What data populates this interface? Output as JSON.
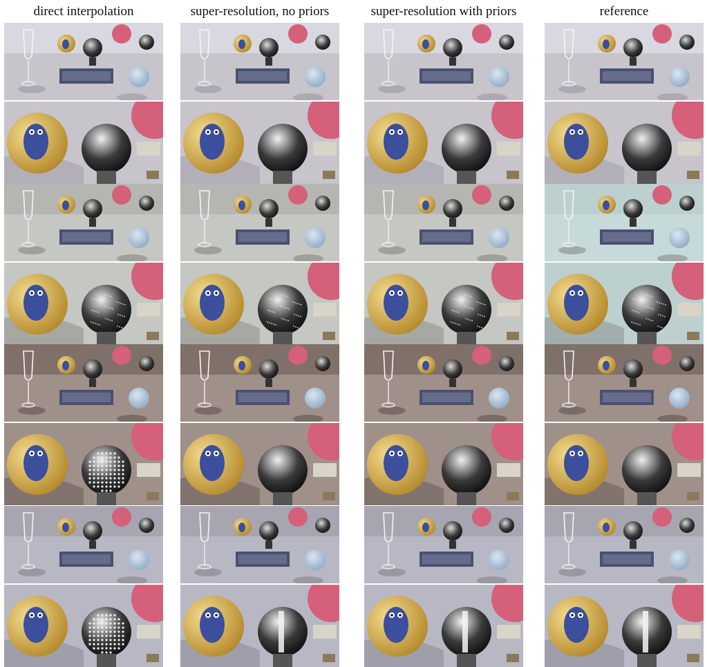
{
  "columns": [
    {
      "label": "direct interpolation"
    },
    {
      "label": "super-resolution, no priors"
    },
    {
      "label": "super-resolution with priors"
    },
    {
      "label": "reference"
    }
  ],
  "scenes": [
    {
      "background": "#d9d7df",
      "table": "#c7c4cc",
      "shadow": "#8f8a95",
      "pattern": "none"
    },
    {
      "background": "#b5b6b1",
      "table": "#c5c7c2",
      "shadow": "#6f716d",
      "pattern": "speckle"
    },
    {
      "background": "#7f706a",
      "table": "#a0908a",
      "shadow": "#4a403c",
      "pattern": "dots"
    },
    {
      "background": "#a6a5b0",
      "table": "#b7b8c3",
      "shadow": "#70717b",
      "pattern": "stripe"
    }
  ],
  "reference_tint": "#bcd0d0",
  "colors": {
    "gold_ornament": "#b58a2c",
    "silver_ornament": "#3a3a3a",
    "pink_ball": "#d4607a",
    "blue_ball": "#8fa9c4",
    "fish_blue": "#3b4f9c",
    "label_box": "#4a5070"
  },
  "icons": {
    "glass": "wine-glass-icon",
    "gold": "gold-ornament-icon",
    "silver": "silver-ornament-icon",
    "pink": "pink-ball-icon",
    "blue": "blue-ball-icon"
  }
}
